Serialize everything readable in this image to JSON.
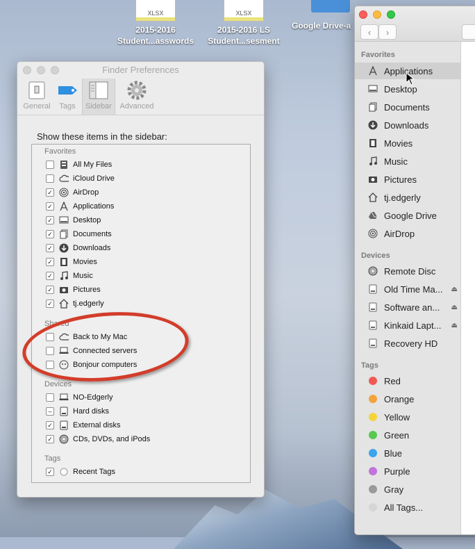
{
  "desktop": {
    "files": [
      {
        "badge": "XLSX",
        "line1": "2015-2016",
        "line2": "Student...asswords"
      },
      {
        "badge": "XLSX",
        "line1": "2015-2016 LS",
        "line2": "Student...sesment"
      }
    ],
    "gdrive_label": "Google Drive-a"
  },
  "prefs": {
    "title": "Finder Preferences",
    "tabs": [
      {
        "label": "General",
        "icon": "general-switch-icon"
      },
      {
        "label": "Tags",
        "icon": "tag-icon"
      },
      {
        "label": "Sidebar",
        "icon": "sidebar-icon",
        "active": true
      },
      {
        "label": "Advanced",
        "icon": "gear-icon"
      }
    ],
    "heading": "Show these items in the sidebar:",
    "sections": {
      "favorites": "Favorites",
      "shared": "Shared",
      "devices": "Devices",
      "tags": "Tags"
    },
    "favorites": [
      {
        "label": "All My Files",
        "checked": false,
        "icon": "all-files-icon"
      },
      {
        "label": "iCloud Drive",
        "checked": false,
        "icon": "cloud-icon"
      },
      {
        "label": "AirDrop",
        "checked": true,
        "icon": "airdrop-icon"
      },
      {
        "label": "Applications",
        "checked": true,
        "icon": "applications-icon"
      },
      {
        "label": "Desktop",
        "checked": true,
        "icon": "desktop-icon"
      },
      {
        "label": "Documents",
        "checked": true,
        "icon": "documents-icon"
      },
      {
        "label": "Downloads",
        "checked": true,
        "icon": "downloads-icon"
      },
      {
        "label": "Movies",
        "checked": true,
        "icon": "movies-icon"
      },
      {
        "label": "Music",
        "checked": true,
        "icon": "music-icon"
      },
      {
        "label": "Pictures",
        "checked": true,
        "icon": "pictures-icon"
      },
      {
        "label": "tj.edgerly",
        "checked": true,
        "icon": "home-icon"
      }
    ],
    "shared": [
      {
        "label": "Back to My Mac",
        "checked": false,
        "icon": "cloud-icon"
      },
      {
        "label": "Connected servers",
        "checked": false,
        "icon": "server-icon"
      },
      {
        "label": "Bonjour computers",
        "checked": false,
        "icon": "bonjour-icon"
      }
    ],
    "devices": [
      {
        "label": "NO-Edgerly",
        "checked": false,
        "icon": "laptop-icon"
      },
      {
        "label": "Hard disks",
        "checked": "mixed",
        "icon": "hard-disk-icon"
      },
      {
        "label": "External disks",
        "checked": true,
        "icon": "external-disk-icon"
      },
      {
        "label": "CDs, DVDs, and iPods",
        "checked": true,
        "icon": "disc-icon"
      }
    ],
    "tags": [
      {
        "label": "Recent Tags",
        "checked": true,
        "icon": "tag-circle-icon"
      }
    ]
  },
  "finder": {
    "sections": {
      "favorites": "Favorites",
      "devices": "Devices",
      "tags": "Tags"
    },
    "favorites": [
      {
        "label": "Applications",
        "icon": "applications-icon",
        "selected": true
      },
      {
        "label": "Desktop",
        "icon": "desktop-icon"
      },
      {
        "label": "Documents",
        "icon": "documents-icon"
      },
      {
        "label": "Downloads",
        "icon": "downloads-icon"
      },
      {
        "label": "Movies",
        "icon": "movies-icon"
      },
      {
        "label": "Music",
        "icon": "music-icon"
      },
      {
        "label": "Pictures",
        "icon": "pictures-icon"
      },
      {
        "label": "tj.edgerly",
        "icon": "home-icon"
      },
      {
        "label": "Google Drive",
        "icon": "google-drive-icon"
      },
      {
        "label": "AirDrop",
        "icon": "airdrop-icon"
      }
    ],
    "devices": [
      {
        "label": "Remote Disc",
        "icon": "disc-icon",
        "eject": false
      },
      {
        "label": "Old Time Ma...",
        "icon": "disk-icon",
        "eject": true
      },
      {
        "label": "Software an...",
        "icon": "disk-icon",
        "eject": true
      },
      {
        "label": "Kinkaid Lapt...",
        "icon": "disk-icon",
        "eject": true
      },
      {
        "label": "Recovery HD",
        "icon": "disk-icon",
        "eject": false
      }
    ],
    "tags": [
      {
        "label": "Red",
        "color": "#f05a52"
      },
      {
        "label": "Orange",
        "color": "#f4a23c"
      },
      {
        "label": "Yellow",
        "color": "#f5d43a"
      },
      {
        "label": "Green",
        "color": "#58c94e"
      },
      {
        "label": "Blue",
        "color": "#3ba4ef"
      },
      {
        "label": "Purple",
        "color": "#c273dc"
      },
      {
        "label": "Gray",
        "color": "#9a9a9a"
      },
      {
        "label": "All Tags...",
        "color": "#d6d6d6"
      }
    ]
  }
}
